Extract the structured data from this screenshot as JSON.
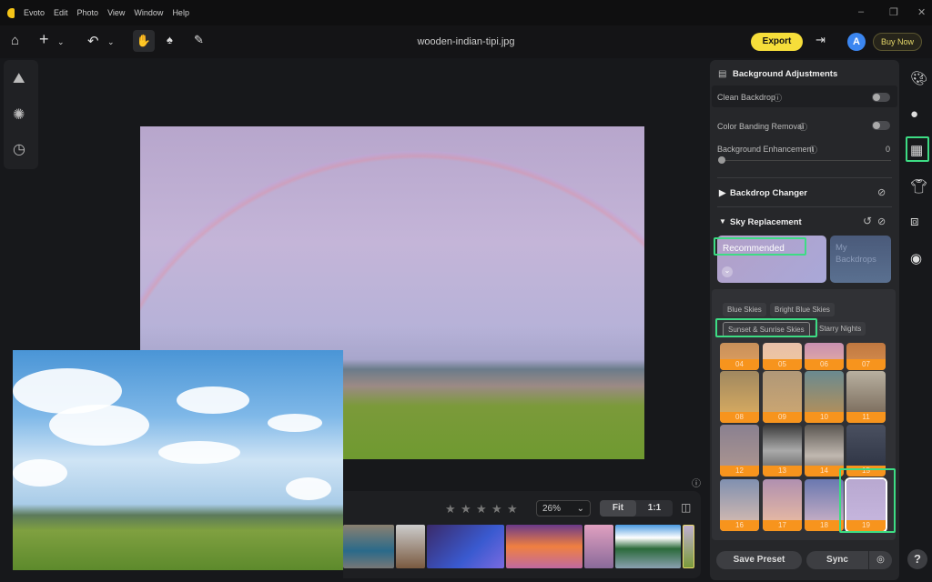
{
  "app": {
    "name": "Evoto",
    "menu": [
      "Edit",
      "Photo",
      "View",
      "Window",
      "Help"
    ]
  },
  "toolbar": {
    "filename": "wooden-indian-tipi.jpg",
    "export": "Export",
    "avatar": "A",
    "buy_now": "Buy Now"
  },
  "view": {
    "rating": 0,
    "zoom": "26%",
    "fit": "Fit",
    "one_to_one": "1:1"
  },
  "panel": {
    "title": "Background Adjustments",
    "clean_backdrop": "Clean Backdrop",
    "clean_backdrop_on": false,
    "color_banding": "Color Banding Removal",
    "color_banding_on": false,
    "bg_enhancement": "Background Enhancement",
    "bg_enhancement_value": "0",
    "backdrop_changer": "Backdrop Changer",
    "sky_replacement": "Sky Replacement",
    "recommended": "Recommended",
    "my_backdrops": "My Backdrops",
    "categories": [
      "Blue Skies",
      "Bright Blue Skies",
      "Sunset & Sunrise Skies",
      "Starry Nights"
    ],
    "selected_category": "Sunset & Sunrise Skies",
    "thumbs": [
      "04",
      "05",
      "06",
      "07",
      "08",
      "09",
      "10",
      "11",
      "12",
      "13",
      "14",
      "15",
      "16",
      "17",
      "18",
      "19"
    ],
    "selected_thumb": "19",
    "save_preset": "Save Preset",
    "sync": "Sync"
  },
  "colors": {
    "accent": "#3ddc84",
    "export": "#f6de3a",
    "thumb_label": "#f7941d"
  }
}
